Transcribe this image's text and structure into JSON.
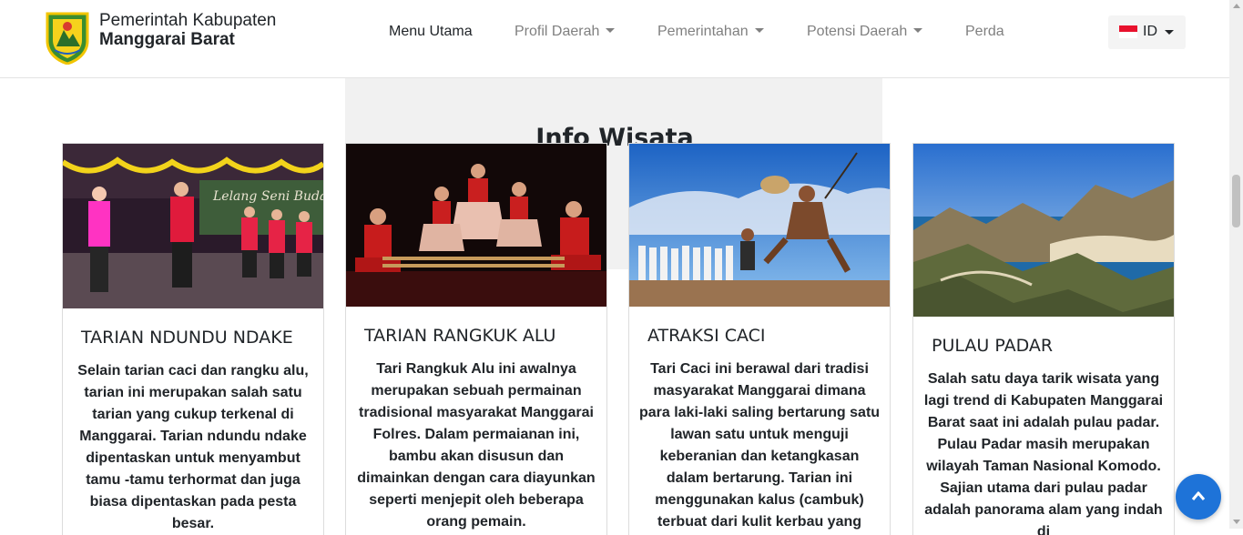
{
  "header": {
    "brand_line1": "Pemerintah Kabupaten",
    "brand_line2": "Manggarai Barat",
    "logo_icon": "regency-crest-icon",
    "nav": [
      {
        "label": "Menu Utama",
        "dropdown": false,
        "active": true
      },
      {
        "label": "Profil Daerah",
        "dropdown": true,
        "active": false
      },
      {
        "label": "Pemerintahan",
        "dropdown": true,
        "active": false
      },
      {
        "label": "Potensi Daerah",
        "dropdown": true,
        "active": false
      },
      {
        "label": "Perda",
        "dropdown": false,
        "active": false
      }
    ],
    "language": {
      "label": "ID",
      "flag_icon": "indonesia-flag-icon"
    }
  },
  "section": {
    "title": "Info Wisata",
    "cards": [
      {
        "title": "TARIAN NDUNDU NDAKE",
        "text": "Selain tarian caci dan rangku alu, tarian ini merupakan salah satu tarian yang cukup terkenal di Manggarai. Tarian ndundu ndake dipentaskan untuk menyambut tamu -tamu terhormat dan juga biasa dipentaskan pada pesta besar."
      },
      {
        "title": "TARIAN RANGKUK ALU",
        "text": "Tari Rangkuk Alu ini awalnya merupakan sebuah permainan tradisional masyarakat Manggarai Folres. Dalam permaianan ini, bambu akan disusun dan dimainkan dengan cara diayunkan seperti menjepit oleh beberapa orang pemain."
      },
      {
        "title": "ATRAKSI CACI",
        "text": "Tari Caci ini berawal dari tradisi masyarakat Manggarai dimana para laki-laki saling bertarung satu lawan satu untuk menguji keberanian dan ketangkasan dalam bertarung. Tarian ini menggunakan kalus (cambuk) terbuat dari kulit kerbau yang"
      },
      {
        "title": "PULAU PADAR",
        "text": "Salah satu daya tarik wisata yang lagi trend di Kabupaten Manggarai Barat saat ini adalah pulau padar. Pulau Padar masih merupakan wilayah Taman Nasional Komodo. Sajian utama dari pulau padar adalah panorama alam yang indah di"
      }
    ]
  },
  "back_to_top_icon": "arrow-up-icon",
  "colors": {
    "accent": "#1e73d8",
    "nav_muted": "#808080",
    "text": "#212529"
  }
}
